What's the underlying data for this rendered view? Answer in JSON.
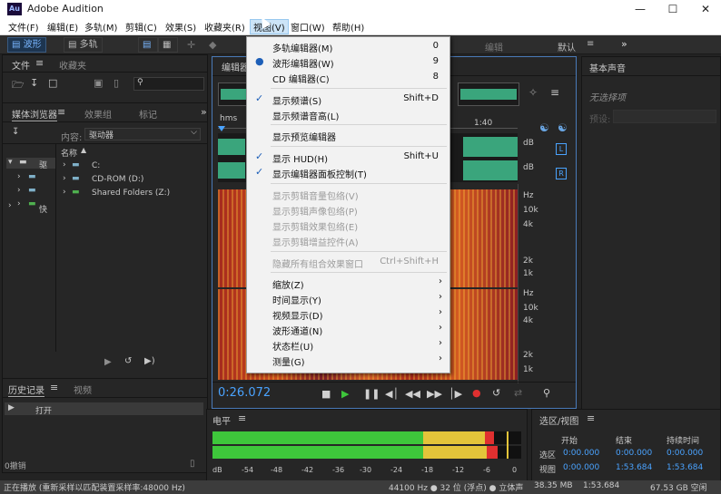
{
  "window": {
    "title": "Adobe Audition",
    "logo": "Au"
  },
  "menubar": [
    "文件(F)",
    "编辑(E)",
    "多轨(M)",
    "剪辑(C)",
    "效果(S)",
    "收藏夹(R)",
    "视图(V)",
    "窗口(W)",
    "帮助(H)"
  ],
  "toolbar": {
    "waveform": "波形",
    "multitrack": "多轨",
    "workspace": "默认",
    "workspace2": "编辑"
  },
  "files_panel": {
    "tab1": "文件",
    "tab2": "收藏夹"
  },
  "media_panel": {
    "tabs": [
      "媒体浏览器",
      "效果组",
      "标记"
    ],
    "content_label": "内容:",
    "content_value": "驱动器",
    "name_header": "名称",
    "left_items": [
      "驱",
      "快"
    ],
    "drives": [
      "C:",
      "CD-ROM (D:)",
      "Shared Folders (Z:)"
    ]
  },
  "history_panel": {
    "tab1": "历史记录",
    "tab2": "视频",
    "item": "打开",
    "undo_count": "0撤销"
  },
  "editor": {
    "tab": "编辑器",
    "ruler_start": "hms",
    "ruler_mark": "1:40",
    "channel_db": [
      "dB",
      "dB"
    ],
    "channel_lr": [
      "L",
      "R"
    ],
    "freq_labels_top": [
      "Hz",
      "10k",
      "4k",
      "2k",
      "1k"
    ],
    "freq_labels_bottom": [
      "Hz",
      "10k",
      "4k",
      "2k",
      "1k"
    ],
    "timecode": "0:26.072"
  },
  "essential_sound": {
    "title": "基本声音",
    "status": "无选择项",
    "preset": "预设:"
  },
  "levels_panel": {
    "title": "电平",
    "scale": [
      "dB",
      "-54",
      "-48",
      "-42",
      "-36",
      "-30",
      "-24",
      "-18",
      "-12",
      "-6",
      "0"
    ]
  },
  "selection_view": {
    "title": "选区/视图",
    "headers": [
      "开始",
      "结束",
      "持续时间"
    ],
    "rows": [
      {
        "label": "选区",
        "start": "0:00.000",
        "end": "0:00.000",
        "duration": "0:00.000"
      },
      {
        "label": "视图",
        "start": "0:00.000",
        "end": "1:53.684",
        "duration": "1:53.684"
      }
    ]
  },
  "statusbar": {
    "left": "正在播放  (重新采样以匹配装置采样率:48000 Hz)",
    "format": "44100 Hz ● 32 位 (浮点)  ● 立体声",
    "size": "38.35 MB",
    "duration": "1:53.684",
    "free": "67.53 GB 空闲"
  },
  "view_menu": {
    "items": [
      {
        "label": "多轨编辑器(M)",
        "shortcut": "0"
      },
      {
        "label": "波形编辑器(W)",
        "shortcut": "9"
      },
      {
        "label": "CD 编辑器(C)",
        "shortcut": "8"
      },
      {
        "label": "显示频谱(S)",
        "shortcut": "Shift+D"
      },
      {
        "label": "显示频谱音高(L)",
        "shortcut": ""
      },
      {
        "label": "显示预览编辑器",
        "shortcut": ""
      },
      {
        "label": "显示 HUD(H)",
        "shortcut": "Shift+U"
      },
      {
        "label": "显示编辑器面板控制(T)",
        "shortcut": ""
      },
      {
        "label": "显示剪辑音量包络(V)",
        "shortcut": ""
      },
      {
        "label": "显示剪辑声像包络(P)",
        "shortcut": ""
      },
      {
        "label": "显示剪辑效果包络(E)",
        "shortcut": ""
      },
      {
        "label": "显示剪辑增益控件(A)",
        "shortcut": ""
      },
      {
        "label": "隐藏所有组合效果窗口",
        "shortcut": "Ctrl+Shift+H"
      },
      {
        "label": "缩放(Z)",
        "shortcut": ""
      },
      {
        "label": "时间显示(Y)",
        "shortcut": ""
      },
      {
        "label": "视频显示(D)",
        "shortcut": ""
      },
      {
        "label": "波形通道(N)",
        "shortcut": ""
      },
      {
        "label": "状态栏(U)",
        "shortcut": ""
      },
      {
        "label": "测量(G)",
        "shortcut": ""
      }
    ]
  },
  "colors": {
    "accent": "#4aa3ff",
    "waveform": "#3aa57c",
    "menu_bg": "#f2f2f2"
  }
}
